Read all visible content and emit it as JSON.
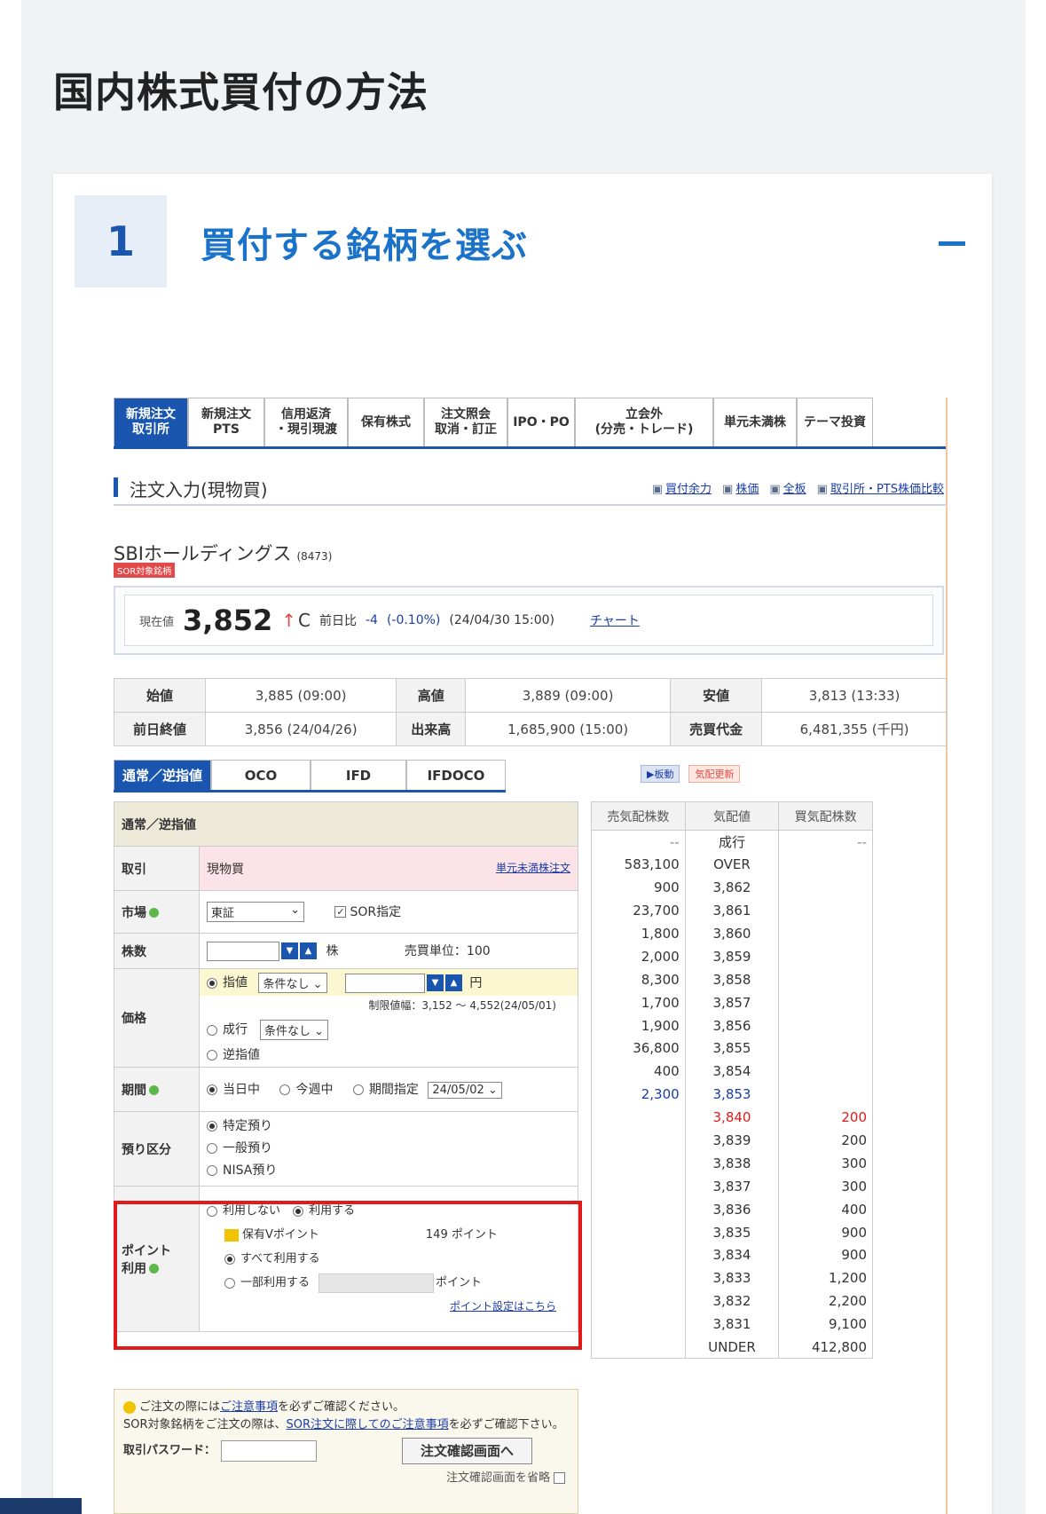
{
  "page_title": "国内株式買付の方法",
  "step": {
    "number": "1",
    "title": "買付する銘柄を選ぶ",
    "collapse_label": ""
  },
  "screenshot": {
    "tabs": [
      {
        "label": "新規注文\n取引所",
        "active": true
      },
      {
        "label": "新規注文\nPTS",
        "active": false
      },
      {
        "label": "信用返済\n・現引現渡",
        "active": false
      },
      {
        "label": "保有株式",
        "active": false
      },
      {
        "label": "注文照会\n取消・訂正",
        "active": false
      },
      {
        "label": "IPO・PO",
        "active": false
      },
      {
        "label": "立会外\n(分売・トレード)",
        "active": false
      },
      {
        "label": "単元未満株",
        "active": false
      },
      {
        "label": "テーマ投資",
        "active": false
      }
    ],
    "order_heading": "注文入力(現物買)",
    "header_links": [
      "買付余力",
      "株価",
      "全板",
      "取引所・PTS株価比較"
    ],
    "stock": {
      "name": "SBIホールディングス",
      "code": "(8473)",
      "badge": "SOR対象銘柄"
    },
    "price": {
      "current_label": "現在値",
      "current": "3,852",
      "arrow": "↑",
      "mark": "C",
      "prev_label": "前日比",
      "change": "-4",
      "change_pct": "(-0.10%)",
      "time": "(24/04/30 15:00)",
      "chart_link": "チャート"
    },
    "ohlc": [
      [
        "始値",
        "3,885 (09:00)",
        "高値",
        "3,889 (09:00)",
        "安値",
        "3,813 (13:33)"
      ],
      [
        "前日終値",
        "3,856 (24/04/26)",
        "出来高",
        "1,685,900 (15:00)",
        "売買代金",
        "6,481,355 (千円)"
      ]
    ],
    "order_tabs": [
      {
        "label": "通常／逆指値",
        "active": true
      },
      {
        "label": "OCO",
        "active": false
      },
      {
        "label": "IFD",
        "active": false
      },
      {
        "label": "IFDOCO",
        "active": false
      }
    ],
    "mini_buttons": [
      "▶板動",
      "気配更新"
    ],
    "form": {
      "section": "通常／逆指値",
      "trade_label": "取引",
      "trade_value": "現物買",
      "trade_link": "単元未満株注文",
      "market_label": "市場",
      "market_value": "東証",
      "sor_label": "SOR指定",
      "qty_label": "株数",
      "qty_unit": "株",
      "lot": "売買単位：100",
      "price_label": "価格",
      "limit": "指値",
      "cond1": "条件なし",
      "yen": "円",
      "range": "制限値幅：3,152 ～ 4,552(24/05/01)",
      "market_order": "成行",
      "cond2": "条件なし",
      "stop": "逆指値",
      "period_label": "期間",
      "today": "当日中",
      "week": "今週中",
      "period_spec": "期間指定",
      "period_date": "24/05/02",
      "account_label": "預り区分",
      "tokutei": "特定預り",
      "ippan": "一般預り",
      "nisa": "NISA預り",
      "point_label": "ポイント\n利用",
      "no_use": "利用しない",
      "use": "利用する",
      "vpoint": "保有Vポイント",
      "vpoint_val": "149 ポイント",
      "all_use": "すべて利用する",
      "part_use": "一部利用する",
      "point_unit": "ポイント",
      "point_link": "ポイント設定はこちら"
    },
    "board": {
      "headers": [
        "売気配株数",
        "気配値",
        "買気配株数"
      ],
      "rows": [
        [
          "--",
          "成行",
          "--",
          ""
        ],
        [
          "583,100",
          "OVER",
          "",
          ""
        ],
        [
          "900",
          "3,862",
          "",
          ""
        ],
        [
          "23,700",
          "3,861",
          "",
          ""
        ],
        [
          "1,800",
          "3,860",
          "",
          ""
        ],
        [
          "2,000",
          "3,859",
          "",
          ""
        ],
        [
          "8,300",
          "3,858",
          "",
          ""
        ],
        [
          "1,700",
          "3,857",
          "",
          ""
        ],
        [
          "1,900",
          "3,856",
          "",
          ""
        ],
        [
          "36,800",
          "3,855",
          "",
          ""
        ],
        [
          "400",
          "3,854",
          "",
          ""
        ],
        [
          "2,300",
          "3,853",
          "",
          "blue"
        ],
        [
          "",
          "3,840",
          "200",
          "red"
        ],
        [
          "",
          "3,839",
          "200",
          ""
        ],
        [
          "",
          "3,838",
          "300",
          ""
        ],
        [
          "",
          "3,837",
          "300",
          ""
        ],
        [
          "",
          "3,836",
          "400",
          ""
        ],
        [
          "",
          "3,835",
          "900",
          ""
        ],
        [
          "",
          "3,834",
          "900",
          ""
        ],
        [
          "",
          "3,833",
          "1,200",
          ""
        ],
        [
          "",
          "3,832",
          "2,200",
          ""
        ],
        [
          "",
          "3,831",
          "9,100",
          ""
        ],
        [
          "",
          "UNDER",
          "412,800",
          ""
        ]
      ]
    },
    "notice": {
      "line1_a": "ご注文の際には",
      "line1_link": "ご注意事項",
      "line1_b": "を必ずご確認ください。",
      "line2_a": "SOR対象銘柄をご注文の際は、",
      "line2_link": "SOR注文に際してのご注意事項",
      "line2_b": "を必ずご確認下さい。",
      "pw_label": "取引パスワード：",
      "confirm_button": "注文確認画面へ",
      "skip": "注文確認画面を省略"
    }
  }
}
